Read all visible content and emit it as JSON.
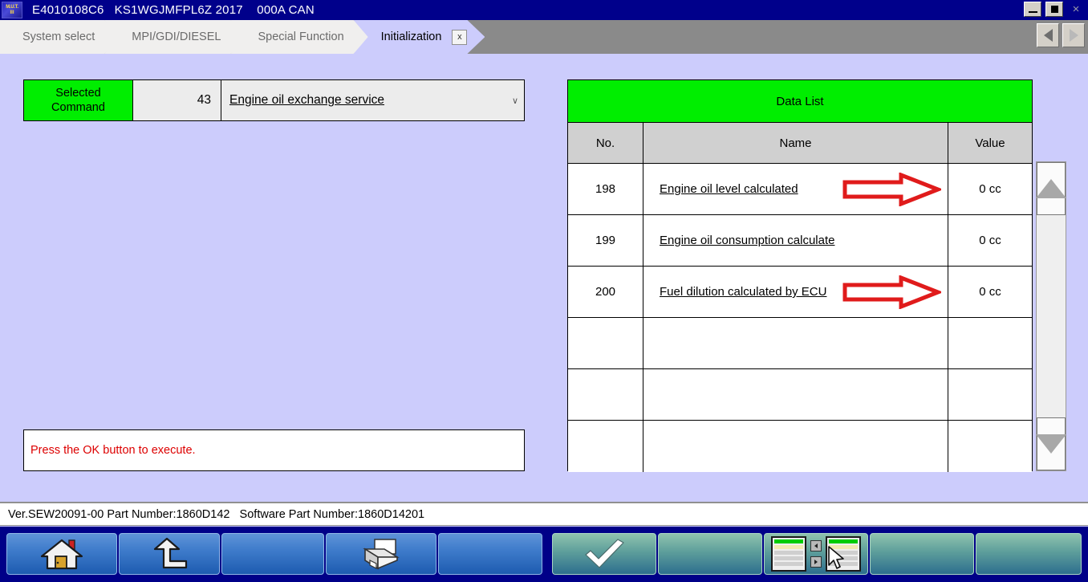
{
  "titlebar": {
    "logo_line1": "M.U.T.",
    "logo_line2": "III",
    "title": "E4010108C6   KS1WGJMFPL6Z 2017    000A CAN",
    "minimize_label": "minimize",
    "maximize_label": "maximize",
    "close_label": "×"
  },
  "tabs": [
    {
      "label": "System select",
      "active": false
    },
    {
      "label": "MPI/GDI/DIESEL",
      "active": false
    },
    {
      "label": "Special Function",
      "active": false
    },
    {
      "label": "Initialization",
      "active": true,
      "close_label": "x"
    }
  ],
  "nav": {
    "prev_label": "previous",
    "next_label": "next"
  },
  "selected_command": {
    "label_line1": "Selected",
    "label_line2": "Command",
    "number": "43",
    "value": "Engine oil exchange service",
    "dropdown_glyph": "∨"
  },
  "message": {
    "text": "Press the OK button to execute."
  },
  "data_list": {
    "title": "Data List",
    "columns": [
      "No.",
      "Name",
      "Value"
    ],
    "rows": [
      {
        "no": "198",
        "name": "Engine oil level calculated",
        "value": "0 cc",
        "arrow": true
      },
      {
        "no": "199",
        "name": "Engine oil consumption calculate",
        "value": "0 cc",
        "arrow": false
      },
      {
        "no": "200",
        "name": "Fuel dilution calculated by ECU",
        "value": "0 cc",
        "arrow": true
      },
      {
        "no": "",
        "name": "",
        "value": "",
        "arrow": false
      },
      {
        "no": "",
        "name": "",
        "value": "",
        "arrow": false
      },
      {
        "no": "",
        "name": "",
        "value": "",
        "arrow": false
      }
    ],
    "scroll_up_label": "scroll up",
    "scroll_down_label": "scroll down"
  },
  "statusbar": {
    "text": "Ver.SEW20091-00 Part Number:1860D142   Software Part Number:1860D14201"
  },
  "toolbar": {
    "left_buttons": [
      {
        "icon": "home-icon",
        "label": "Home"
      },
      {
        "icon": "back-icon",
        "label": "Back"
      },
      {
        "icon": "none",
        "label": ""
      },
      {
        "icon": "printer-icon",
        "label": "Print"
      },
      {
        "icon": "none",
        "label": ""
      }
    ],
    "right_buttons": [
      {
        "icon": "check-icon",
        "label": "OK"
      },
      {
        "icon": "none",
        "label": ""
      },
      {
        "icon": "data-list-icon",
        "label": "Data list select"
      },
      {
        "icon": "none",
        "label": ""
      },
      {
        "icon": "none",
        "label": ""
      }
    ]
  },
  "colors": {
    "title_bar": "#00008b",
    "content_bg": "#ccccfc",
    "accent_green": "#00ee00",
    "message_red": "#dd0000",
    "toolbar_bg": "#000088",
    "annotation_red": "#e01b1b"
  }
}
